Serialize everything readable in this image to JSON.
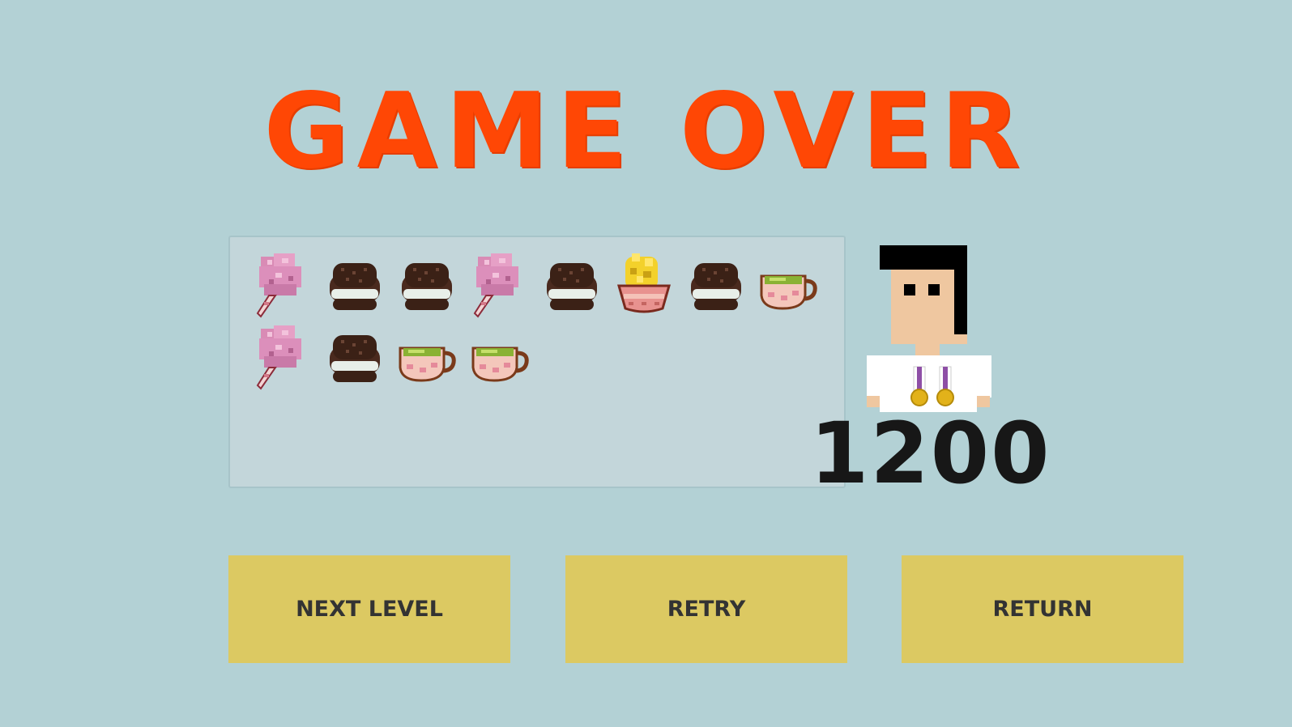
{
  "screen": {
    "title": "GAME OVER",
    "background_color": "#b3d1d5",
    "title_color": "#ff4705"
  },
  "inventory": {
    "items": [
      {
        "icon": "cotton-candy-icon"
      },
      {
        "icon": "cookie-sandwich-icon"
      },
      {
        "icon": "cookie-sandwich-icon"
      },
      {
        "icon": "cotton-candy-icon"
      },
      {
        "icon": "cookie-sandwich-icon"
      },
      {
        "icon": "popcorn-bowl-icon"
      },
      {
        "icon": "cookie-sandwich-icon"
      },
      {
        "icon": "tea-cup-icon"
      },
      {
        "icon": "cotton-candy-icon"
      },
      {
        "icon": "cookie-sandwich-icon"
      },
      {
        "icon": "tea-cup-icon"
      },
      {
        "icon": "tea-cup-icon"
      }
    ]
  },
  "player": {
    "avatar_icon": "player-with-medals-icon",
    "score": "1200"
  },
  "buttons": {
    "next_level": "NEXT LEVEL",
    "retry": "RETRY",
    "return": "RETURN",
    "color": "#dcc962"
  }
}
